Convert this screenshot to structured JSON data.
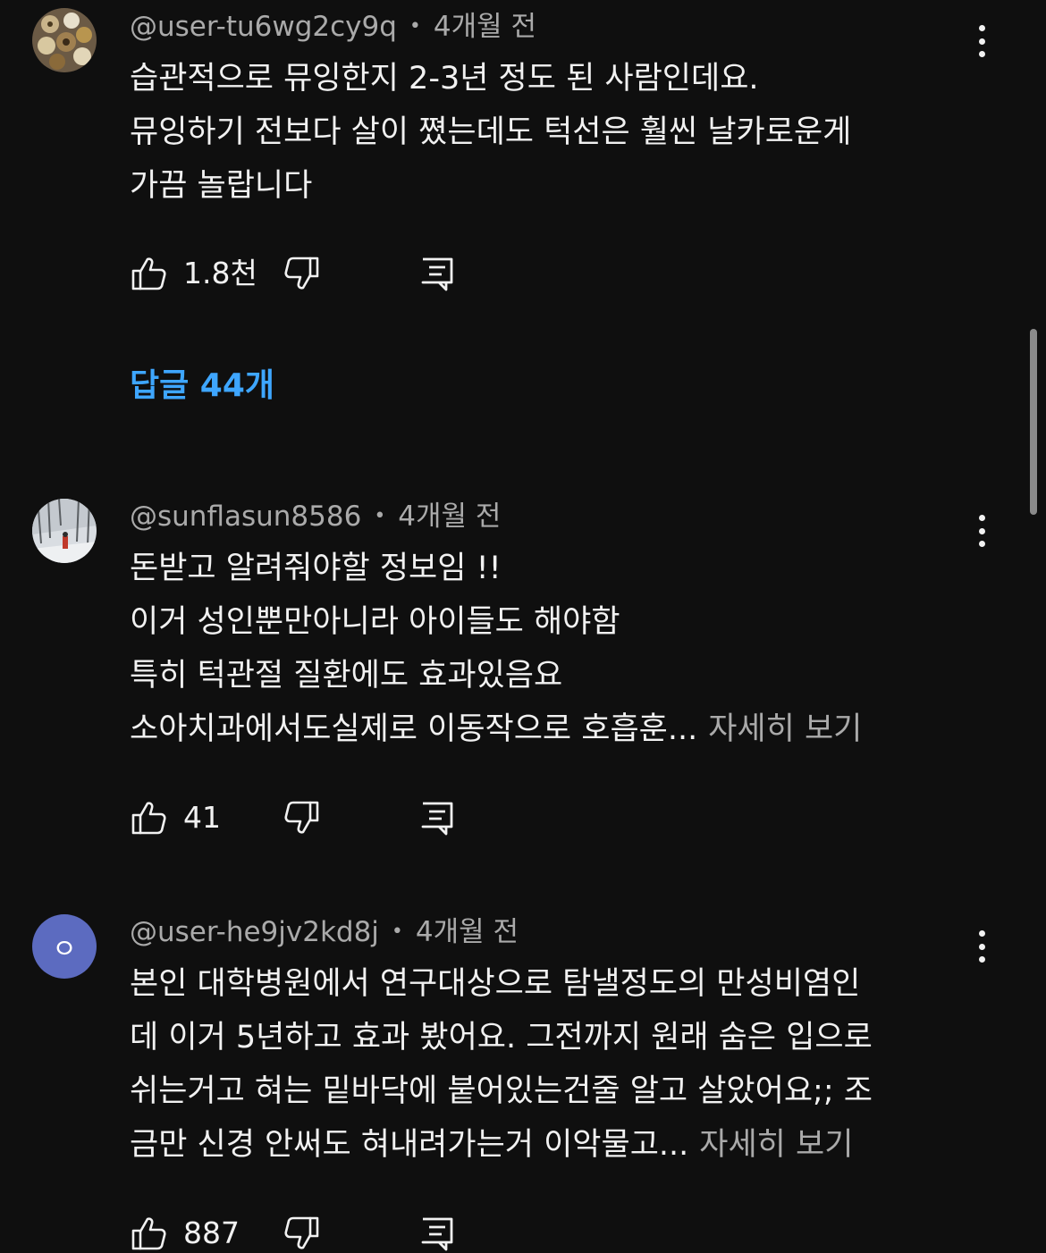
{
  "comments": [
    {
      "author": "@user-tu6wg2cy9q",
      "time": "4개월 전",
      "lines": [
        "습관적으로 뮤잉한지 2-3년 정도 된 사람인데요.",
        "뮤잉하기 전보다 살이 쪘는데도 턱선은 훨씬 날카로운게",
        "가끔 놀랍니다"
      ],
      "more": "",
      "likes": "1.8천"
    },
    {
      "author": "@sunflasun8586",
      "time": "4개월 전",
      "lines": [
        "돈받고 알려줘야할 정보임 !!",
        "이거 성인뿐만아니라 아이들도 해야함",
        "특히 턱관절 질환에도 효과있음요",
        "소아치과에서도실제로 이동작으로 호흡훈..."
      ],
      "more": "자세히 보기",
      "likes": "41"
    },
    {
      "author": "@user-he9jv2kd8j",
      "time": "4개월 전",
      "avatar_letter": "ㅇ",
      "lines": [
        "본인 대학병원에서 연구대상으로 탐낼정도의 만성비염인",
        "데 이거 5년하고 효과 봤어요. 그전까지 원래 숨은 입으로",
        "쉬는거고 혀는 밑바닥에 붙어있는건줄 알고 살았어요;; 조",
        "금만 신경 안써도 혀내려가는거 이악물고..."
      ],
      "more": "자세히 보기",
      "likes": "887"
    }
  ],
  "replies_label": "답글 44개",
  "colors": {
    "background": "#0f0f0f",
    "text": "#f1f1f1",
    "meta": "#aaaaaa",
    "link": "#3ea6ff",
    "avatar_purple": "#5c6bc0"
  },
  "icons": {
    "like": "thumbs-up-icon",
    "dislike": "thumbs-down-icon",
    "reply": "reply-icon",
    "menu": "more-vert-icon"
  }
}
